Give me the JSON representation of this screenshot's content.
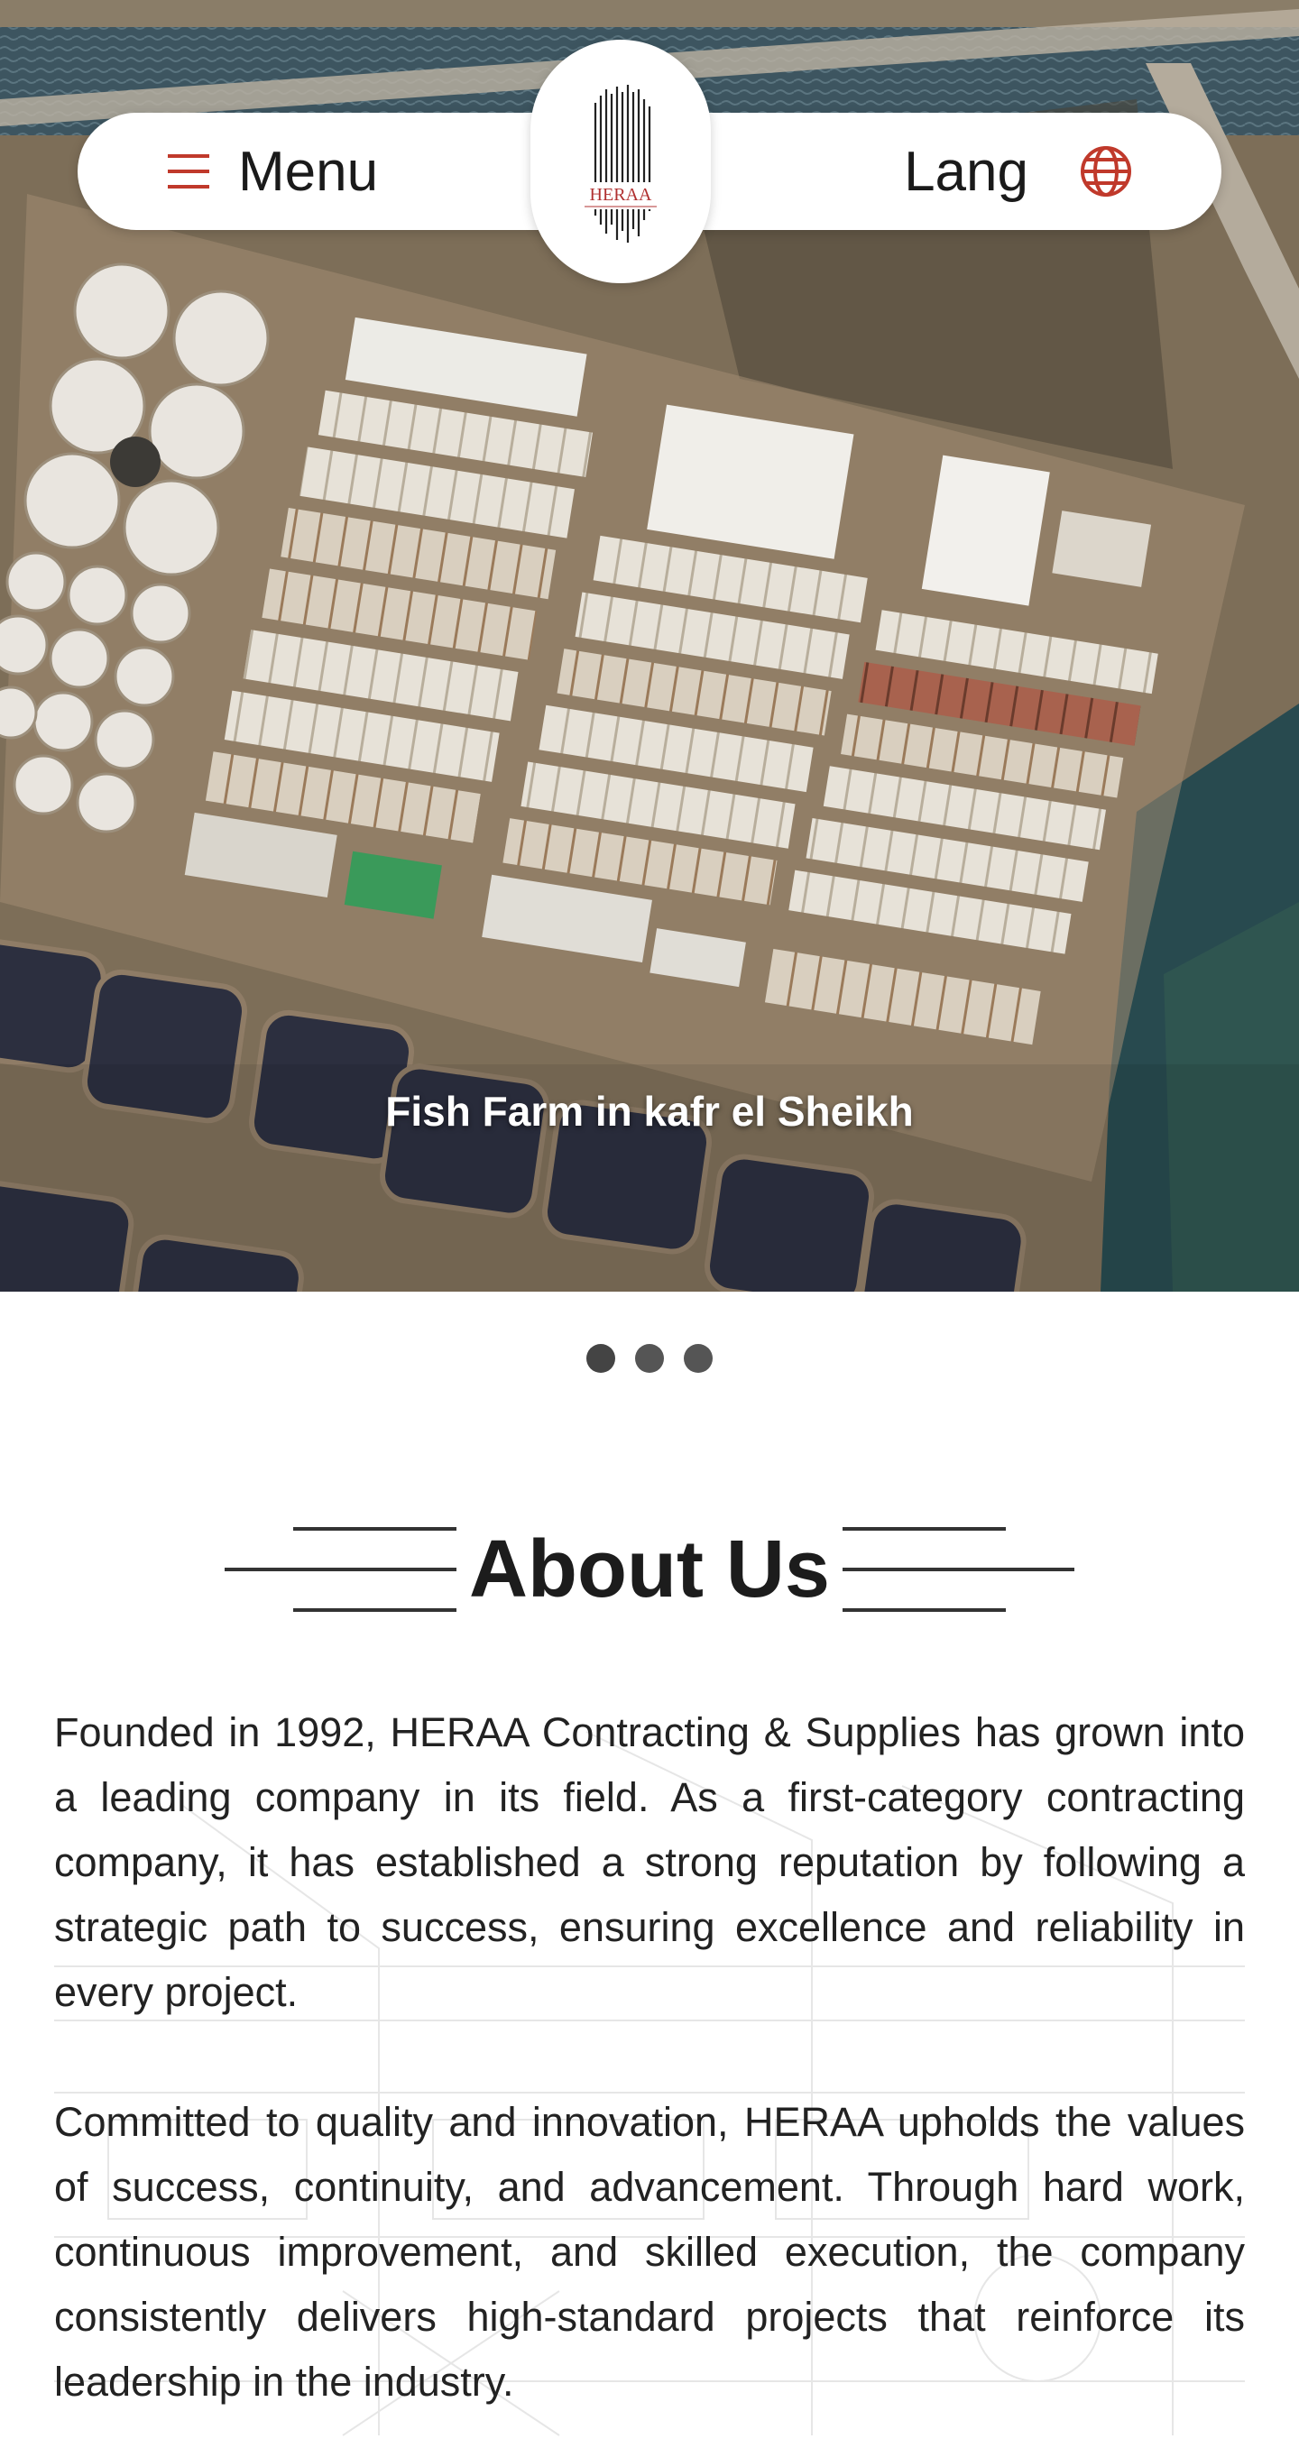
{
  "header": {
    "menu_label": "Menu",
    "lang_label": "Lang",
    "logo_text": "HERAA",
    "menu_icon": "hamburger-icon",
    "lang_icon": "globe-icon",
    "accent_color": "#c0392b"
  },
  "hero": {
    "caption": "Fish Farm in kafr el Sheikh",
    "slide_count": 3,
    "active_slide": 1
  },
  "about": {
    "title": "About Us",
    "paragraphs": [
      "Founded in 1992, HERAA Contracting & Supplies has grown into a leading company in its field. As a first-category contracting company, it has established a strong reputation by following a strategic path to success, ensuring excellence and reliability in every project.",
      "Committed to quality and innovation, HERAA upholds the values of success, continuity, and advancement. Through hard work, continuous improvement, and skilled execution, the company consistently delivers high-standard projects that reinforce its leadership in the industry."
    ]
  }
}
